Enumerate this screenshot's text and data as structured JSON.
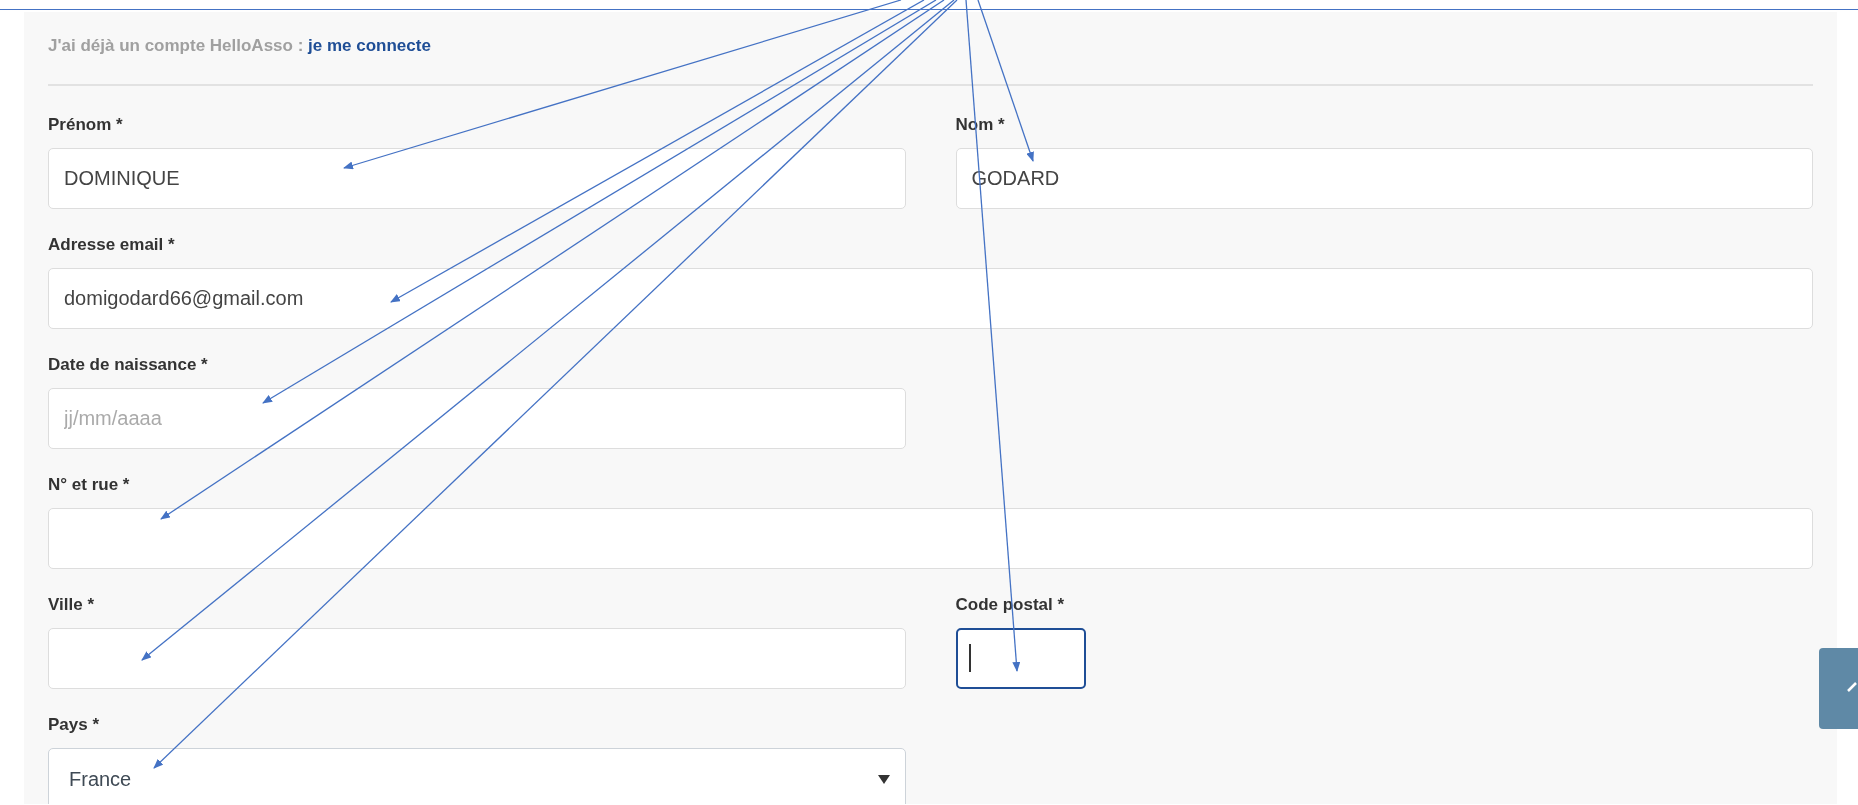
{
  "account_prompt": {
    "text": "J'ai déjà un compte HelloAsso :",
    "link": "je me connecte"
  },
  "rows": [
    {
      "fields": [
        {
          "kind": "text",
          "label": "Prénom *",
          "value": "DOMINIQUE",
          "focused": false
        },
        {
          "kind": "text",
          "label": "Nom *",
          "value": "GODARD",
          "focused": false
        }
      ]
    },
    {
      "fields": [
        {
          "kind": "text",
          "label": "Adresse email *",
          "value": "domigodard66@gmail.com",
          "focused": false
        }
      ]
    },
    {
      "fields": [
        {
          "kind": "text",
          "label": "Date de naissance *",
          "placeholder": "jj/mm/aaaa",
          "focused": false
        }
      ]
    },
    {
      "fields": [
        {
          "kind": "text",
          "label": "N° et rue *",
          "focused": false
        }
      ]
    },
    {
      "fields": [
        {
          "kind": "text",
          "label": "Ville *",
          "focused": false
        },
        {
          "kind": "text",
          "label": "Code postal *",
          "focused": true
        }
      ]
    },
    {
      "fields": [
        {
          "kind": "select",
          "label": "Pays *",
          "value": "France",
          "focused": false
        }
      ]
    }
  ]
}
